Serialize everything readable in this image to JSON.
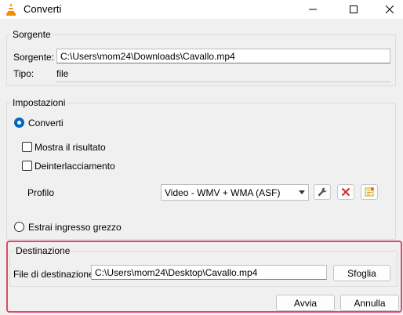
{
  "window": {
    "title": "Converti"
  },
  "sorgente": {
    "group_title": "Sorgente",
    "label": "Sorgente:",
    "value": "C:\\Users\\mom24\\Downloads\\Cavallo.mp4",
    "tipo_label": "Tipo:",
    "tipo_value": "file"
  },
  "impostazioni": {
    "group_title": "Impostazioni",
    "converti_label": "Converti",
    "mostra_label": "Mostra il risultato",
    "deinterlaccia_label": "Deinterlacciamento",
    "profilo_label": "Profilo",
    "profilo_value": "Video - WMV + WMA (ASF)",
    "estrai_label": "Estrai ingresso grezzo"
  },
  "destinazione": {
    "group_title": "Destinazione",
    "file_label": "File di destinazione:",
    "file_value": "C:\\Users\\mom24\\Desktop\\Cavallo.mp4",
    "browse_label": "Sfoglia"
  },
  "footer": {
    "start_label": "Avvia",
    "cancel_label": "Annulla"
  },
  "icons": {
    "app": "vlc-cone-icon",
    "edit_profile": "wrench-icon",
    "delete_profile": "red-x-icon",
    "new_profile": "new-profile-icon"
  },
  "colors": {
    "accent": "#0067c0",
    "highlight": "#e0486a",
    "delete": "#d32f2f",
    "vlc_orange": "#f28c00"
  }
}
